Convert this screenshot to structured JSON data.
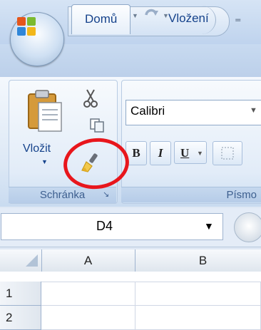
{
  "qat": {
    "save_icon": "save-icon",
    "undo_icon": "undo-icon",
    "redo_icon": "redo-icon",
    "customize_icon": "customize-qat-icon"
  },
  "tabs": [
    {
      "label": "Domů",
      "selected": true
    },
    {
      "label": "Vložení",
      "selected": false
    }
  ],
  "clipboard": {
    "paste_label": "Vložit",
    "group_title": "Schránka"
  },
  "font_group": {
    "font_name": "Calibri",
    "group_title": "Písmo",
    "bold": "B",
    "italic": "I",
    "underline": "U"
  },
  "formula_bar": {
    "name_box_value": "D4"
  },
  "sheet": {
    "columns": [
      "A",
      "B"
    ],
    "rows": [
      "1",
      "2"
    ]
  },
  "colors": {
    "highlight_circle": "#e8161c",
    "accent_text": "#15428b"
  }
}
